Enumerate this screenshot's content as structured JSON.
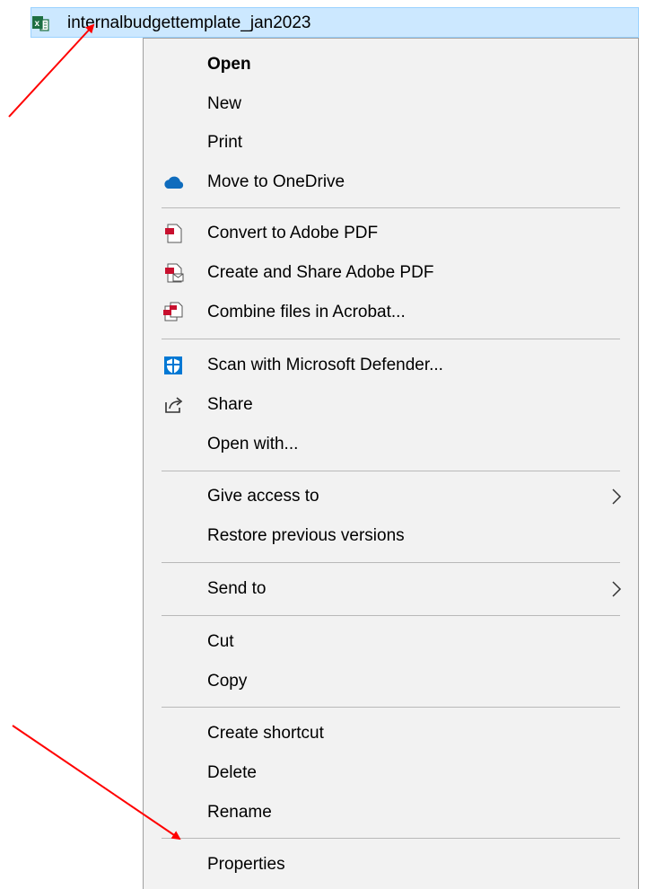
{
  "file": {
    "icon": "excel-file-icon",
    "name": "internalbudgettemplate_jan2023"
  },
  "menu": {
    "items": [
      {
        "label": "Open",
        "icon": null
      },
      {
        "label": "New",
        "icon": null
      },
      {
        "label": "Print",
        "icon": null
      },
      {
        "label": "Move to OneDrive",
        "icon": "onedrive-cloud-icon"
      },
      {
        "label": "Convert to Adobe PDF",
        "icon": "adobe-pdf-icon"
      },
      {
        "label": "Create and Share Adobe PDF",
        "icon": "adobe-pdf-share-icon"
      },
      {
        "label": "Combine files in Acrobat...",
        "icon": "acrobat-combine-icon"
      },
      {
        "label": "Scan with Microsoft Defender...",
        "icon": "defender-shield-icon"
      },
      {
        "label": "Share",
        "icon": "share-icon"
      },
      {
        "label": "Open with...",
        "icon": null
      },
      {
        "label": "Give access to",
        "icon": null,
        "submenu": true
      },
      {
        "label": "Restore previous versions",
        "icon": null
      },
      {
        "label": "Send to",
        "icon": null,
        "submenu": true
      },
      {
        "label": "Cut",
        "icon": null
      },
      {
        "label": "Copy",
        "icon": null
      },
      {
        "label": "Create shortcut",
        "icon": null
      },
      {
        "label": "Delete",
        "icon": null
      },
      {
        "label": "Rename",
        "icon": null
      },
      {
        "label": "Properties",
        "icon": null
      }
    ]
  },
  "annotations": {
    "arrow_color": "#ff0000"
  },
  "colors": {
    "selection_bg": "#cce8ff",
    "selection_border": "#99d1ff",
    "menu_bg": "#f2f2f2",
    "onedrive_blue": "#0f6cbd",
    "adobe_red": "#c8102e",
    "defender_blue": "#0078d4",
    "excel_green": "#1d6f42"
  }
}
